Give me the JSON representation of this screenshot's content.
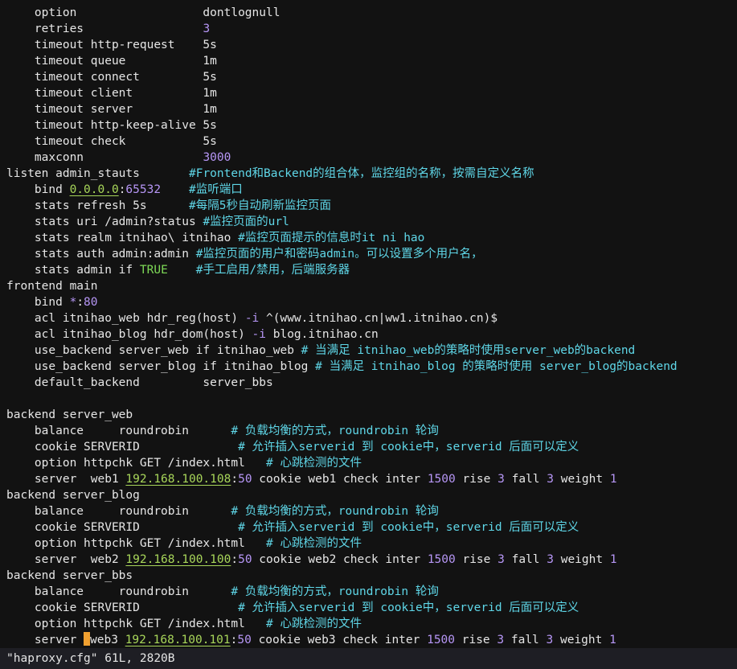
{
  "lines": [
    [
      {
        "t": "    option                  dontlognull",
        "c": ""
      }
    ],
    [
      {
        "t": "    retries                 ",
        "c": ""
      },
      {
        "t": "3",
        "c": "num"
      }
    ],
    [
      {
        "t": "    timeout http-request    5s",
        "c": ""
      }
    ],
    [
      {
        "t": "    timeout queue           1m",
        "c": ""
      }
    ],
    [
      {
        "t": "    timeout connect         5s",
        "c": ""
      }
    ],
    [
      {
        "t": "    timeout client          1m",
        "c": ""
      }
    ],
    [
      {
        "t": "    timeout server          1m",
        "c": ""
      }
    ],
    [
      {
        "t": "    timeout http-keep-alive 5s",
        "c": ""
      }
    ],
    [
      {
        "t": "    timeout check           5s",
        "c": ""
      }
    ],
    [
      {
        "t": "    maxconn                 ",
        "c": ""
      },
      {
        "t": "3000",
        "c": "num"
      }
    ],
    [
      {
        "t": "listen admin_stauts       ",
        "c": ""
      },
      {
        "t": "#Frontend和Backend的组合体，监控组的名称，按需自定义名称",
        "c": "cm"
      }
    ],
    [
      {
        "t": "    bind ",
        "c": ""
      },
      {
        "t": "0.0.0.0",
        "c": "ip"
      },
      {
        "t": ":",
        "c": ""
      },
      {
        "t": "65532",
        "c": "num"
      },
      {
        "t": "    ",
        "c": ""
      },
      {
        "t": "#监听端口",
        "c": "cm"
      }
    ],
    [
      {
        "t": "    stats refresh 5s      ",
        "c": ""
      },
      {
        "t": "#每隔5秒自动刷新监控页面",
        "c": "cm"
      }
    ],
    [
      {
        "t": "    stats uri /admin?status ",
        "c": ""
      },
      {
        "t": "#监控页面的url",
        "c": "cm"
      }
    ],
    [
      {
        "t": "    stats realm itnihao\\ itnihao ",
        "c": ""
      },
      {
        "t": "#监控页面提示的信息时it ni hao",
        "c": "cm"
      }
    ],
    [
      {
        "t": "    stats auth admin:admin ",
        "c": ""
      },
      {
        "t": "#监控页面的用户和密码admin。可以设置多个用户名，",
        "c": "cm"
      }
    ],
    [
      {
        "t": "    stats admin if ",
        "c": ""
      },
      {
        "t": "TRUE",
        "c": "kw"
      },
      {
        "t": "    ",
        "c": ""
      },
      {
        "t": "#手工启用/禁用，后端服务器",
        "c": "cm"
      }
    ],
    [
      {
        "t": "frontend main",
        "c": ""
      }
    ],
    [
      {
        "t": "    bind ",
        "c": ""
      },
      {
        "t": "*",
        "c": "num"
      },
      {
        "t": ":",
        "c": ""
      },
      {
        "t": "80",
        "c": "num"
      }
    ],
    [
      {
        "t": "    acl itnihao_web hdr_reg(host) ",
        "c": ""
      },
      {
        "t": "-i",
        "c": "num"
      },
      {
        "t": " ^(www.itnihao.cn|ww1.itnihao.cn)$",
        "c": ""
      }
    ],
    [
      {
        "t": "    acl itnihao_blog hdr_dom(host) ",
        "c": ""
      },
      {
        "t": "-i",
        "c": "num"
      },
      {
        "t": " blog.itnihao.cn",
        "c": ""
      }
    ],
    [
      {
        "t": "    use_backend server_web if itnihao_web ",
        "c": ""
      },
      {
        "t": "# 当满足 itnihao_web的策略时使用server_web的backend",
        "c": "cm"
      }
    ],
    [
      {
        "t": "    use_backend server_blog if itnihao_blog ",
        "c": ""
      },
      {
        "t": "# 当满足 itnihao_blog 的策略时使用 server_blog的backend",
        "c": "cm"
      }
    ],
    [
      {
        "t": "    default_backend         server_bbs",
        "c": ""
      }
    ],
    [
      {
        "t": "",
        "c": ""
      }
    ],
    [
      {
        "t": "backend server_web",
        "c": ""
      }
    ],
    [
      {
        "t": "    balance     roundrobin      ",
        "c": ""
      },
      {
        "t": "# 负载均衡的方式，roundrobin 轮询",
        "c": "cm"
      }
    ],
    [
      {
        "t": "    cookie SERVERID              ",
        "c": ""
      },
      {
        "t": "# 允许插入serverid 到 cookie中，serverid 后面可以定义",
        "c": "cm"
      }
    ],
    [
      {
        "t": "    option httpchk GET /index.html   ",
        "c": ""
      },
      {
        "t": "# 心跳检测的文件",
        "c": "cm"
      }
    ],
    [
      {
        "t": "    server  web1 ",
        "c": ""
      },
      {
        "t": "192.168.100.108",
        "c": "ip"
      },
      {
        "t": ":",
        "c": ""
      },
      {
        "t": "50",
        "c": "num"
      },
      {
        "t": " cookie web1 check inter ",
        "c": ""
      },
      {
        "t": "1500",
        "c": "num"
      },
      {
        "t": " rise ",
        "c": ""
      },
      {
        "t": "3",
        "c": "num"
      },
      {
        "t": " fall ",
        "c": ""
      },
      {
        "t": "3",
        "c": "num"
      },
      {
        "t": " weight ",
        "c": ""
      },
      {
        "t": "1",
        "c": "num"
      }
    ],
    [
      {
        "t": "backend server_blog",
        "c": ""
      }
    ],
    [
      {
        "t": "    balance     roundrobin      ",
        "c": ""
      },
      {
        "t": "# 负载均衡的方式，roundrobin 轮询",
        "c": "cm"
      }
    ],
    [
      {
        "t": "    cookie SERVERID              ",
        "c": ""
      },
      {
        "t": "# 允许插入serverid 到 cookie中，serverid 后面可以定义",
        "c": "cm"
      }
    ],
    [
      {
        "t": "    option httpchk GET /index.html   ",
        "c": ""
      },
      {
        "t": "# 心跳检测的文件",
        "c": "cm"
      }
    ],
    [
      {
        "t": "    server  web2 ",
        "c": ""
      },
      {
        "t": "192.168.100.100",
        "c": "ip"
      },
      {
        "t": ":",
        "c": ""
      },
      {
        "t": "50",
        "c": "num"
      },
      {
        "t": " cookie web2 check inter ",
        "c": ""
      },
      {
        "t": "1500",
        "c": "num"
      },
      {
        "t": " rise ",
        "c": ""
      },
      {
        "t": "3",
        "c": "num"
      },
      {
        "t": " fall ",
        "c": ""
      },
      {
        "t": "3",
        "c": "num"
      },
      {
        "t": " weight ",
        "c": ""
      },
      {
        "t": "1",
        "c": "num"
      }
    ],
    [
      {
        "t": "backend server_bbs",
        "c": ""
      }
    ],
    [
      {
        "t": "    balance     roundrobin      ",
        "c": ""
      },
      {
        "t": "# 负载均衡的方式，roundrobin 轮询",
        "c": "cm"
      }
    ],
    [
      {
        "t": "    cookie SERVERID              ",
        "c": ""
      },
      {
        "t": "# 允许插入serverid 到 cookie中，serverid 后面可以定义",
        "c": "cm"
      }
    ],
    [
      {
        "t": "    option httpchk GET /index.html   ",
        "c": ""
      },
      {
        "t": "# 心跳检测的文件",
        "c": "cm"
      }
    ],
    [
      {
        "t": "    server ",
        "c": ""
      },
      {
        "t": "",
        "c": "cursor"
      },
      {
        "t": "web3 ",
        "c": ""
      },
      {
        "t": "192.168.100.101",
        "c": "ip"
      },
      {
        "t": ":",
        "c": ""
      },
      {
        "t": "50",
        "c": "num"
      },
      {
        "t": " cookie web3 check inter ",
        "c": ""
      },
      {
        "t": "1500",
        "c": "num"
      },
      {
        "t": " rise ",
        "c": ""
      },
      {
        "t": "3",
        "c": "num"
      },
      {
        "t": " fall ",
        "c": ""
      },
      {
        "t": "3",
        "c": "num"
      },
      {
        "t": " weight ",
        "c": ""
      },
      {
        "t": "1",
        "c": "num"
      }
    ]
  ],
  "status": {
    "text": "\"haproxy.cfg\" 61L, 2820B"
  },
  "colors": {
    "background": "#121212",
    "text": "#e6e6e6",
    "comment": "#5fd7e8",
    "number": "#b696f5",
    "ip": "#a8d65a",
    "keyword": "#7ed957",
    "cursor": "#f0a030"
  }
}
